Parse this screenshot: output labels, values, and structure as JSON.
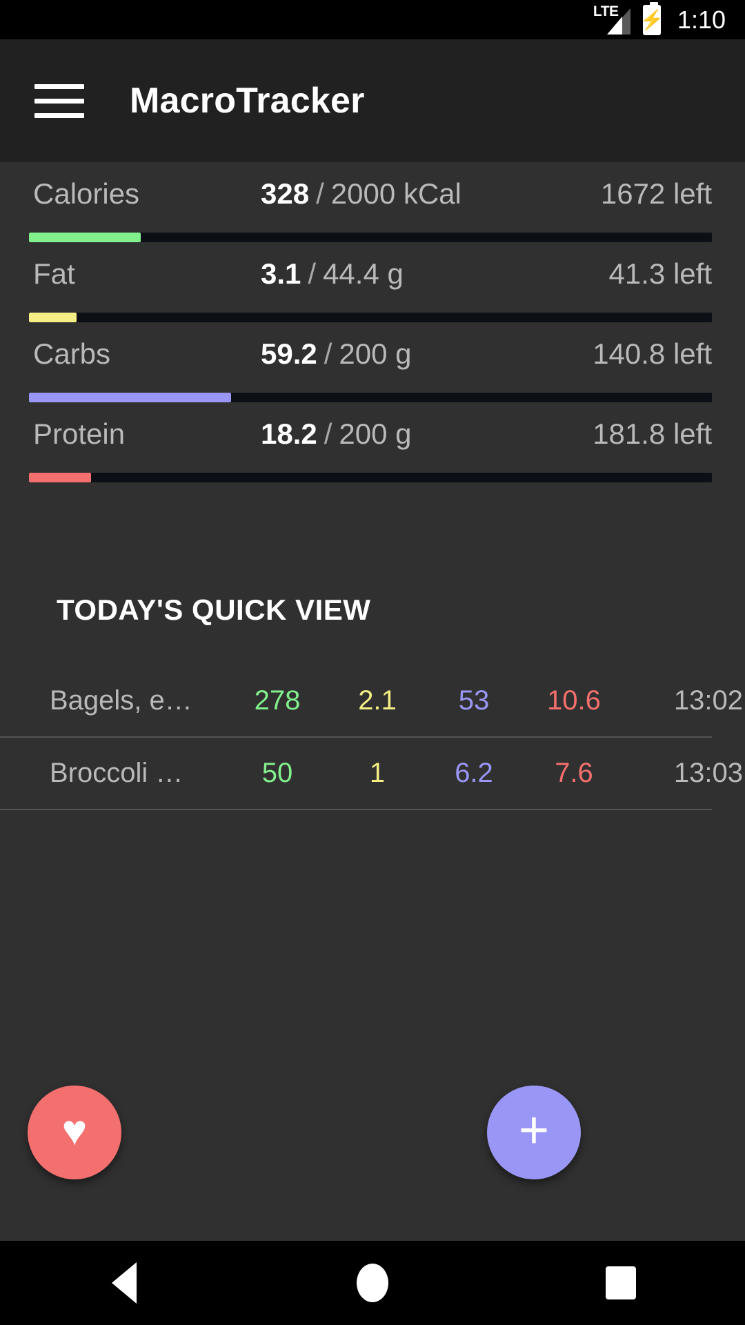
{
  "status_bar": {
    "network_label": "LTE",
    "time": "1:10",
    "battery_icon": "battery-charging-icon",
    "signal_icon": "signal-bars-icon"
  },
  "app_bar": {
    "menu_icon": "hamburger-menu-icon",
    "title": "MacroTracker"
  },
  "macros": [
    {
      "name": "Calories",
      "current": "328",
      "separator": "/",
      "goal": "2000 kCal",
      "remaining": "1672 left",
      "percent": 16.4,
      "color": "#82F08C"
    },
    {
      "name": "Fat",
      "current": "3.1",
      "separator": "/",
      "goal": "44.4 g",
      "remaining": "41.3 left",
      "percent": 7.0,
      "color": "#F4EE85"
    },
    {
      "name": "Carbs",
      "current": "59.2",
      "separator": "/",
      "goal": "200 g",
      "remaining": "140.8 left",
      "percent": 29.6,
      "color": "#9A96F5"
    },
    {
      "name": "Protein",
      "current": "18.2",
      "separator": "/",
      "goal": "200 g",
      "remaining": "181.8 left",
      "percent": 9.1,
      "color": "#F4706E"
    }
  ],
  "quick_view": {
    "title": "TODAY'S QUICK VIEW",
    "rows": [
      {
        "name": "Bagels, e…",
        "calories": "278",
        "fat": "2.1",
        "carbs": "53",
        "protein": "10.6",
        "time": "13:02"
      },
      {
        "name": "Broccoli …",
        "calories": "50",
        "fat": "1",
        "carbs": "6.2",
        "protein": "7.6",
        "time": "13:03"
      }
    ]
  },
  "fabs": {
    "favorites": {
      "icon": "heart-icon",
      "glyph": "♥",
      "color": "#F4706E"
    },
    "add": {
      "icon": "plus-icon",
      "glyph": "+",
      "color": "#9A96F5"
    }
  },
  "nav_bar": {
    "back": "back-triangle-icon",
    "home": "home-circle-icon",
    "recents": "recents-square-icon"
  },
  "colors": {
    "calories": "#82F08C",
    "fat": "#F4EE85",
    "carbs": "#9A96F5",
    "protein": "#F4706E",
    "background": "#303030",
    "app_bar": "#212121",
    "track": "#0d0f16"
  }
}
